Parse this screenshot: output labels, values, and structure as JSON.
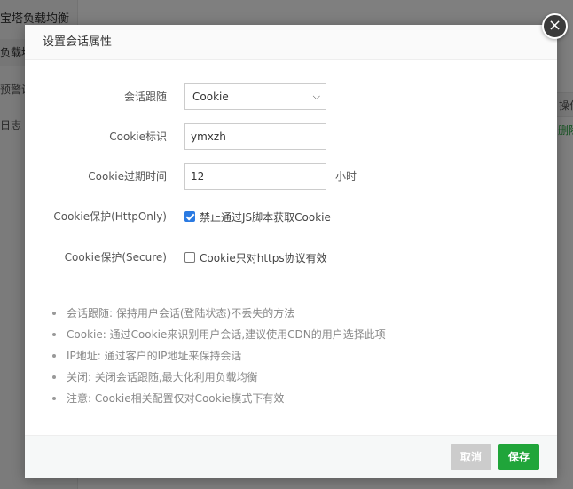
{
  "background": {
    "app_title": "宝塔负载均衡",
    "nav": [
      "负载均",
      "预警设",
      "日志"
    ],
    "table_header": "操作",
    "table_cell": "删除"
  },
  "dialog": {
    "title": "设置会话属性",
    "close_symbol": "×",
    "session_tracking": {
      "label": "会话跟随",
      "value": "Cookie",
      "options": [
        "Cookie"
      ]
    },
    "cookie_id": {
      "label": "Cookie标识",
      "value": "ymxzh"
    },
    "cookie_expire": {
      "label": "Cookie过期时间",
      "value": "12",
      "unit": "小时"
    },
    "http_only": {
      "label": "Cookie保护(HttpOnly)",
      "text": "禁止通过JS脚本获取Cookie",
      "checked": true
    },
    "secure": {
      "label": "Cookie保护(Secure)",
      "text": "Cookie只对https协议有效",
      "checked": false
    },
    "tips": [
      "会话跟随: 保持用户会话(登陆状态)不丢失的方法",
      "Cookie: 通过Cookie来识别用户会话,建议使用CDN的用户选择此项",
      "IP地址: 通过客户的IP地址来保持会话",
      "关闭: 关闭会话跟随,最大化利用负载均衡",
      "注意: Cookie相关配置仅对Cookie模式下有效"
    ],
    "cancel_label": "取消",
    "save_label": "保存"
  },
  "colors": {
    "accent": "#20a53a",
    "checkbox": "#2a7ae2",
    "cancel": "#cccccc"
  },
  "icons": {
    "close": "close-icon",
    "select_caret": "chevron-down-icon",
    "tip_bullet": "bullet-dot-icon"
  }
}
